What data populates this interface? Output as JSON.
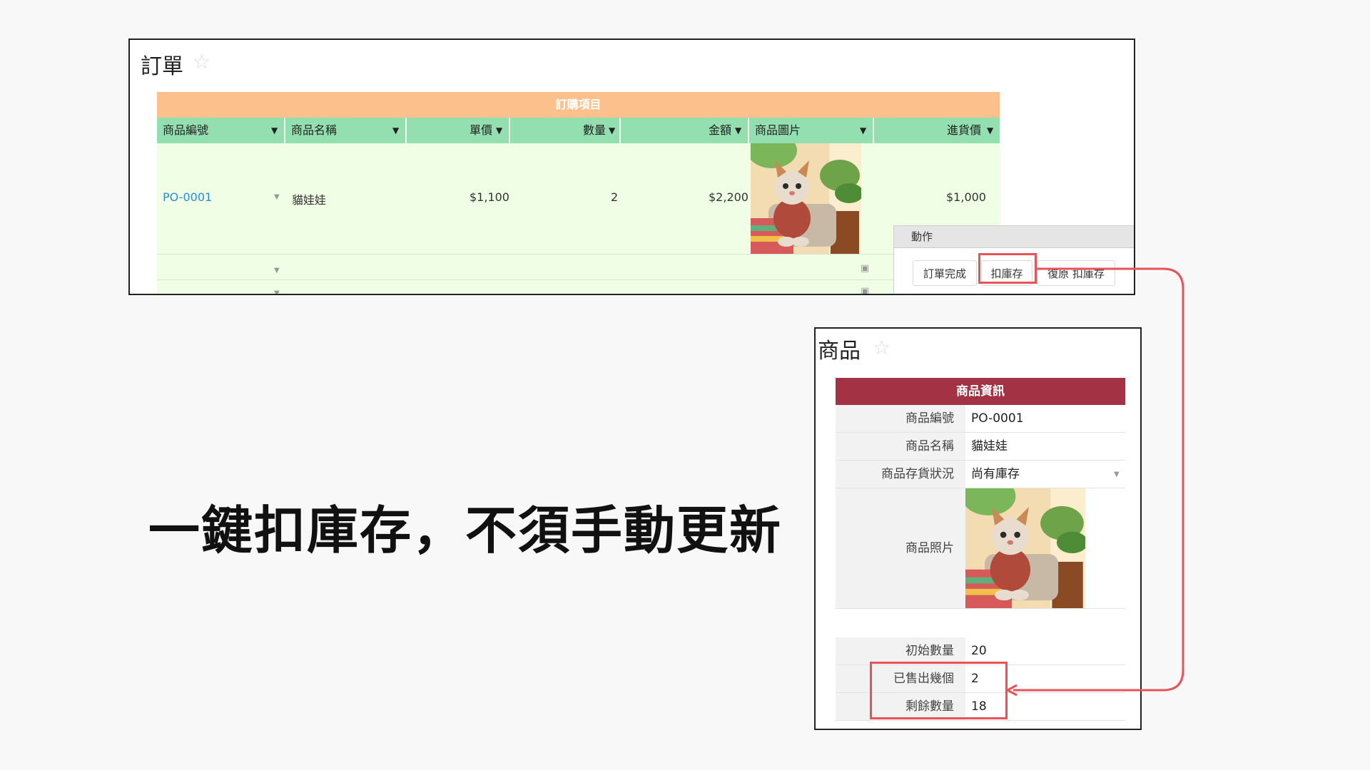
{
  "order_panel": {
    "title": "訂單",
    "group_header": "訂購項目",
    "columns": [
      "商品編號",
      "商品名稱",
      "單價",
      "數量",
      "金額",
      "商品圖片",
      "進貨價"
    ],
    "row": {
      "product_id": "PO-0001",
      "product_name": "貓娃娃",
      "unit_price": "$1,100",
      "quantity": "2",
      "amount": "$2,200",
      "cost_price": "$1,000"
    },
    "colors": {
      "group_header": "#fcc08d",
      "column_header": "#93dfb0",
      "row_bg": "#f1fee6",
      "link": "#2a8fd0"
    }
  },
  "action_panel": {
    "title": "動作",
    "buttons": [
      "訂單完成",
      "扣庫存",
      "復原 扣庫存"
    ],
    "highlighted_button": "扣庫存"
  },
  "product_panel": {
    "title": "商品",
    "section_title": "商品資訊",
    "fields": [
      {
        "label": "商品編號",
        "value": "PO-0001"
      },
      {
        "label": "商品名稱",
        "value": "貓娃娃"
      },
      {
        "label": "商品存貨狀況",
        "value": "尚有庫存"
      },
      {
        "label": "商品照片",
        "value": ""
      }
    ],
    "stock": [
      {
        "label": "初始數量",
        "value": "20"
      },
      {
        "label": "已售出幾個",
        "value": "2"
      },
      {
        "label": "剩餘數量",
        "value": "18"
      }
    ],
    "colors": {
      "section_header": "#a33244"
    }
  },
  "headline": "一鍵扣庫存，不須手動更新",
  "accent_color": "#e75357",
  "icons": [
    "star-icon",
    "dropdown-caret-icon",
    "image-placeholder-icon",
    "arrow-connector"
  ]
}
